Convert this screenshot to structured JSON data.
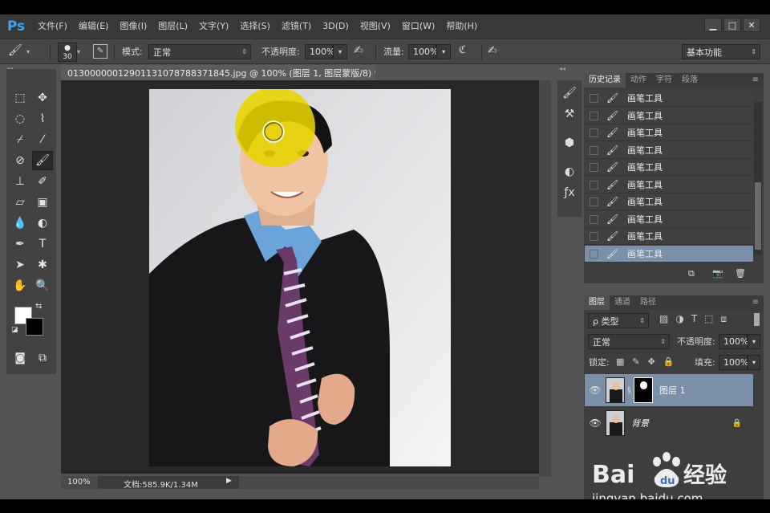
{
  "menu": {
    "logo": "Ps",
    "items": [
      "文件(F)",
      "编辑(E)",
      "图像(I)",
      "图层(L)",
      "文字(Y)",
      "选择(S)",
      "滤镜(T)",
      "3D(D)",
      "视图(V)",
      "窗口(W)",
      "帮助(H)"
    ]
  },
  "options": {
    "brush_size": "30",
    "mode_label": "模式:",
    "mode_value": "正常",
    "opacity_label": "不透明度:",
    "opacity_value": "100%",
    "flow_label": "流量:",
    "flow_value": "100%",
    "workspace": "基本功能"
  },
  "document": {
    "tab_title": "01300000012901131078788371845.jpg @ 100% (图层 1, 图层蒙版/8) *",
    "close": "×",
    "zoom": "100%",
    "doc_size": "文档:585.9K/1.34M"
  },
  "history": {
    "tabs": [
      "历史记录",
      "动作",
      "字符",
      "段落"
    ],
    "items": [
      "画笔工具",
      "画笔工具",
      "画笔工具",
      "画笔工具",
      "画笔工具",
      "画笔工具",
      "画笔工具",
      "画笔工具",
      "画笔工具",
      "画笔工具"
    ],
    "selected_index": 9
  },
  "layers": {
    "tabs": [
      "图层",
      "通道",
      "路径"
    ],
    "filter_label": "ρ 类型",
    "blend_mode": "正常",
    "opacity_label": "不透明度:",
    "opacity_value": "100%",
    "lock_label": "锁定:",
    "fill_label": "填充:",
    "fill_value": "100%",
    "items": [
      {
        "name": "图层 1",
        "selected": true
      },
      {
        "name": "背景",
        "selected": false
      }
    ]
  },
  "watermark": {
    "brand": "Bai",
    "brand2": "经验",
    "url": "jingyan.baidu.com"
  },
  "colors": {
    "menubar": "#383838",
    "panel": "#3e3e3e",
    "selected": "#7b8fa8",
    "brush_cursor": "#e6d400"
  }
}
